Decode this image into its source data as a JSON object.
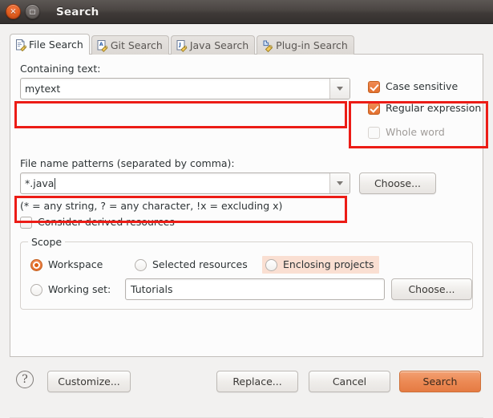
{
  "window": {
    "title": "Search",
    "close_icon": "close-icon",
    "maximize_icon": "maximize-icon",
    "close_glyph": "×",
    "maximize_glyph": "□"
  },
  "tabs": [
    {
      "label": "File Search",
      "icon": "file-search-icon",
      "active": true
    },
    {
      "label": "Git Search",
      "icon": "git-search-icon",
      "active": false
    },
    {
      "label": "Java Search",
      "icon": "java-search-icon",
      "active": false
    },
    {
      "label": "Plug-in Search",
      "icon": "plugin-search-icon",
      "active": false
    }
  ],
  "containing_text": {
    "label": "Containing text:",
    "value": "mytext",
    "dropdown_icon": "chevron-down-icon"
  },
  "options": {
    "case_sensitive": {
      "label": "Case sensitive",
      "checked": true,
      "enabled": true
    },
    "regular_expression": {
      "label": "Regular expression",
      "checked": true,
      "enabled": true
    },
    "whole_word": {
      "label": "Whole word",
      "checked": false,
      "enabled": false
    }
  },
  "file_patterns": {
    "label": "File name patterns (separated by comma):",
    "value": "*.java",
    "hint": "(* = any string, ? = any character, !x = excluding x)",
    "choose_label": "Choose...",
    "dropdown_icon": "chevron-down-icon"
  },
  "derived": {
    "label": "Consider derived resources",
    "checked": false
  },
  "scope": {
    "title": "Scope",
    "workspace": {
      "label": "Workspace",
      "selected": true
    },
    "selected_resources": {
      "label": "Selected resources",
      "selected": false
    },
    "enclosing_projects": {
      "label": "Enclosing projects",
      "selected": false,
      "highlighted": true
    },
    "working_set": {
      "label": "Working set:",
      "selected": false
    },
    "working_set_value": "Tutorials",
    "choose_label": "Choose..."
  },
  "footer": {
    "help_icon": "help-icon",
    "help_glyph": "?",
    "customize_label": "Customize...",
    "replace_label": "Replace...",
    "cancel_label": "Cancel",
    "search_label": "Search"
  },
  "colors": {
    "accent_orange": "#e57b43",
    "annotation_red": "#ec1c16",
    "highlight_peach": "#fadfd2",
    "dialog_bg": "#f2f1f0",
    "panel_bg": "#fcfcfc"
  }
}
